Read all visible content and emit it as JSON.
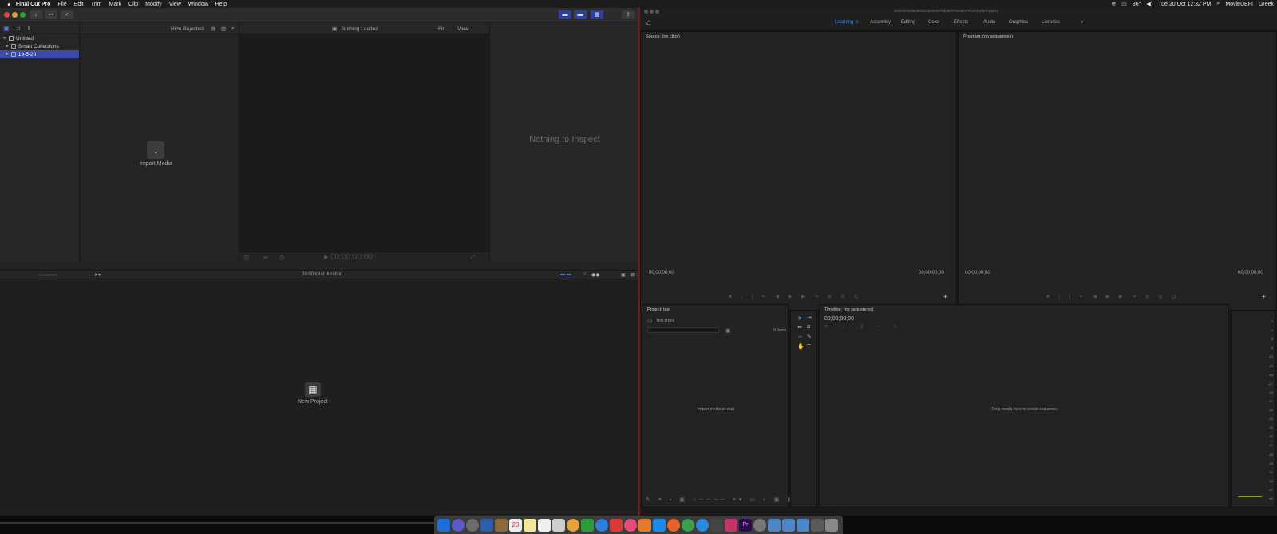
{
  "menubar": {
    "apple": "",
    "app": "Final Cut Pro",
    "items": [
      "File",
      "Edit",
      "Trim",
      "Mark",
      "Clip",
      "Modify",
      "View",
      "Window",
      "Help"
    ],
    "right": {
      "temp": "36°",
      "date": "Tue 20 Oct  12:32 PM",
      "user": "MovieUEFI",
      "lang": "Greek"
    }
  },
  "fcp": {
    "library": {
      "name": "Untitled",
      "smart": "Smart Collections",
      "event": "19-5-20"
    },
    "browser": {
      "filter": "Hide Rejected",
      "import_label": "Import Media"
    },
    "viewer": {
      "status": "Nothing Loaded",
      "fit": "Fit",
      "view": "View",
      "timecode": "00:00:00:00"
    },
    "inspector": {
      "empty": "Nothing to Inspect"
    },
    "timeline": {
      "duration": "00:00 total duration",
      "new_project": "New Project"
    }
  },
  "premiere": {
    "path": "/Users/movieuefi/Documents/Adobe/Premiere Pro/14.0/test.prproj",
    "workspaces": [
      "Learning",
      "Assembly",
      "Editing",
      "Color",
      "Effects",
      "Audio",
      "Graphics",
      "Libraries"
    ],
    "source": {
      "title": "Source: (no clips)",
      "tc_left": "00;00;00;00",
      "tc_right": "00;00;00;00"
    },
    "program": {
      "title": "Program: (no sequences)",
      "tc_left": "00;00;00;00",
      "tc_right": "00;00;00;00"
    },
    "project": {
      "title": "Project: test",
      "file": "test.prproj",
      "items": "0 Items",
      "empty": "Import media to start"
    },
    "timeline": {
      "title": "Timeline: (no sequences)",
      "tc": "00;00;00;00",
      "empty": "Drop media here to create sequence."
    },
    "meter_ticks": [
      "0",
      "-3",
      "-6",
      "-9",
      "-12",
      "-15",
      "-18",
      "-21",
      "-24",
      "-27",
      "-30",
      "-33",
      "-36",
      "-39",
      "-42",
      "-45",
      "-48",
      "-51",
      "-54",
      "-57",
      "dB"
    ]
  },
  "colors": {
    "accent": "#3a4ca8",
    "premiere_blue": "#2d8ceb"
  }
}
